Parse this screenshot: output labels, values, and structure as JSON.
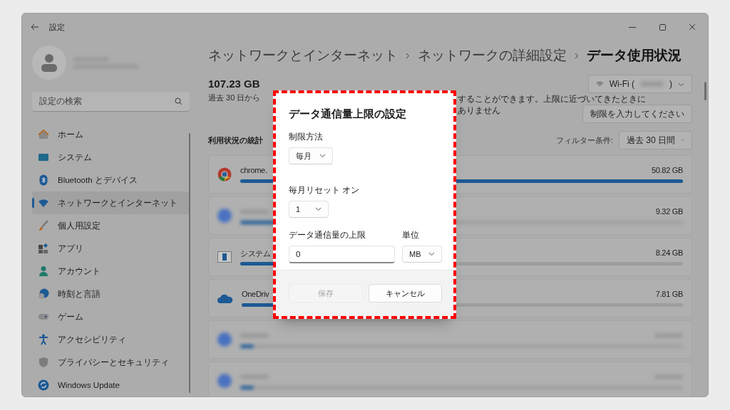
{
  "window": {
    "title": "設定"
  },
  "sidebar": {
    "search": {
      "placeholder": "設定の検索"
    },
    "items": [
      {
        "label": "ホーム",
        "selected": false
      },
      {
        "label": "システム",
        "selected": false
      },
      {
        "label": "Bluetooth とデバイス",
        "selected": false
      },
      {
        "label": "ネットワークとインターネット",
        "selected": true
      },
      {
        "label": "個人用設定",
        "selected": false
      },
      {
        "label": "アプリ",
        "selected": false
      },
      {
        "label": "アカウント",
        "selected": false
      },
      {
        "label": "時刻と言語",
        "selected": false
      },
      {
        "label": "ゲーム",
        "selected": false
      },
      {
        "label": "アクセシビリティ",
        "selected": false
      },
      {
        "label": "プライバシーとセキュリティ",
        "selected": false
      },
      {
        "label": "Windows Update",
        "selected": false
      }
    ]
  },
  "breadcrumb": [
    {
      "label": "ネットワークとインターネット",
      "current": false
    },
    {
      "label": "ネットワークの詳細設定",
      "current": false
    },
    {
      "label": "データ使用状況",
      "current": true
    }
  ],
  "summary": {
    "total": "107.23 GB",
    "period": "過去 30 日から"
  },
  "limit_notice": [
    "することができます。上限に近づいてきたときに",
    "ありません"
  ],
  "network_select": {
    "prefix": "Wi-Fi (",
    "suffix": ")"
  },
  "limit_button": "制限を入力してください",
  "stats": {
    "title": "利用状況の統計",
    "filter_label": "フィルター条件:",
    "filter_value": "過去 30 日間"
  },
  "apps": [
    {
      "kind": "app",
      "name": "chrome.",
      "usage": "50.82 GB",
      "level": 1
    },
    {
      "kind": "blurred",
      "usage": "9.32 GB",
      "level": 0.18
    },
    {
      "kind": "app",
      "name": "システム",
      "usage": "8.24 GB",
      "level": 0.16
    },
    {
      "kind": "app",
      "name": "OneDriv",
      "usage": "7.81 GB",
      "level": 0.15
    },
    {
      "kind": "blurred",
      "level": 0.03
    },
    {
      "kind": "blurred",
      "level": 0.03
    }
  ],
  "dialog": {
    "title": "データ通信量上限の設定",
    "method": {
      "label": "制限方法",
      "value": "毎月"
    },
    "reset": {
      "label": "毎月リセット オン",
      "value": "1"
    },
    "limit": {
      "label": "データ通信量の上限",
      "value": "0"
    },
    "unit": {
      "label": "単位",
      "value": "MB"
    },
    "buttons": [
      {
        "label": "保存",
        "disabled": true
      },
      {
        "label": "キャンセル",
        "disabled": false
      }
    ]
  }
}
